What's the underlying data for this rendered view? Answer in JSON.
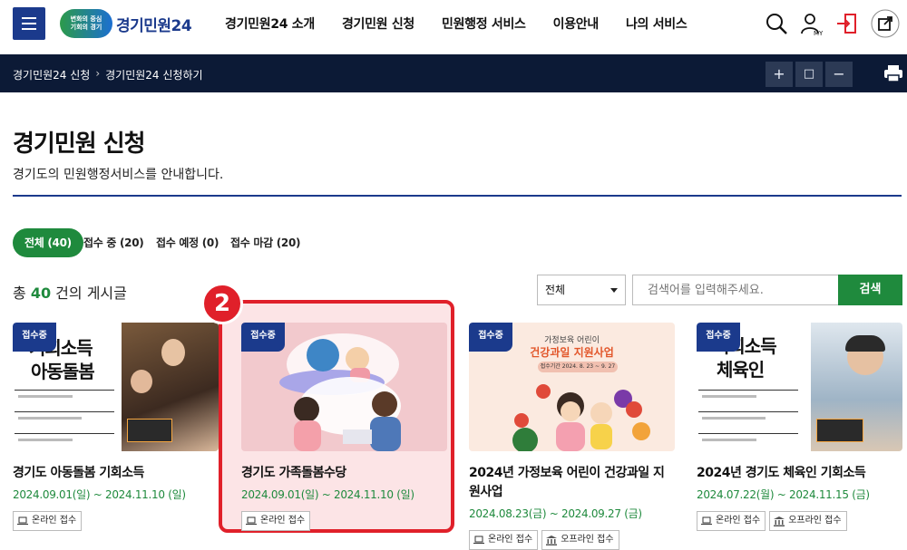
{
  "header": {
    "logo_badge": "변화의 중심\n기회의 경기",
    "logo_text": "경기민원24",
    "nav": [
      "경기민원24 소개",
      "경기민원 신청",
      "민원행정 서비스",
      "이용안내",
      "나의 서비스"
    ],
    "my_label": "MY"
  },
  "breadcrumb": [
    "경기민원24 신청",
    "경기민원24 신청하기"
  ],
  "toolbar": {
    "zoom_in": "+",
    "reset": "□",
    "zoom_out": "−"
  },
  "page": {
    "title": "경기민원 신청",
    "description": "경기도의 민원행정서비스를 안내합니다."
  },
  "tabs": [
    "전체 (40)",
    "접수 중 (20)",
    "접수 예정 (0)",
    "접수 마감 (20)"
  ],
  "list": {
    "count_prefix": "총 ",
    "count": "40",
    "count_suffix": " 건의 게시글"
  },
  "search": {
    "select_value": "전체",
    "placeholder": "검색어를 입력해주세요.",
    "button": "검색"
  },
  "annotation_number": "2",
  "cards": [
    {
      "badge": "접수중",
      "image_text": [
        "기회소득",
        "아동돌봄"
      ],
      "title": "경기도 아동돌봄 기회소득",
      "date": "2024.09.01(일) ~ 2024.11.10 (일)",
      "chips": [
        "온라인 접수"
      ]
    },
    {
      "badge": "접수중",
      "title": "경기도 가족돌봄수당",
      "date": "2024.09.01(일) ~ 2024.11.10 (일)",
      "chips": [
        "온라인 접수"
      ]
    },
    {
      "badge": "접수중",
      "image_text": [
        "가정보육 어린이",
        "건강과일 지원사업",
        "접수기간 2024. 8. 23 ~ 9. 27"
      ],
      "title": "2024년 가정보육 어린이 건강과일 지원사업",
      "date": "2024.08.23(금) ~ 2024.09.27 (금)",
      "chips": [
        "온라인 접수",
        "오프라인 접수"
      ]
    },
    {
      "badge": "접수중",
      "image_text": [
        "기회소득",
        "체육인"
      ],
      "title": "2024년 경기도 체육인 기회소득",
      "date": "2024.07.22(월) ~ 2024.11.15 (금)",
      "chips": [
        "온라인 접수",
        "오프라인 접수"
      ]
    }
  ],
  "colors": {
    "brand_navy": "#1b3a8c",
    "accent_green": "#1f8a3d",
    "dark_bar": "#0c1a36",
    "highlight_red": "#e0202a"
  }
}
